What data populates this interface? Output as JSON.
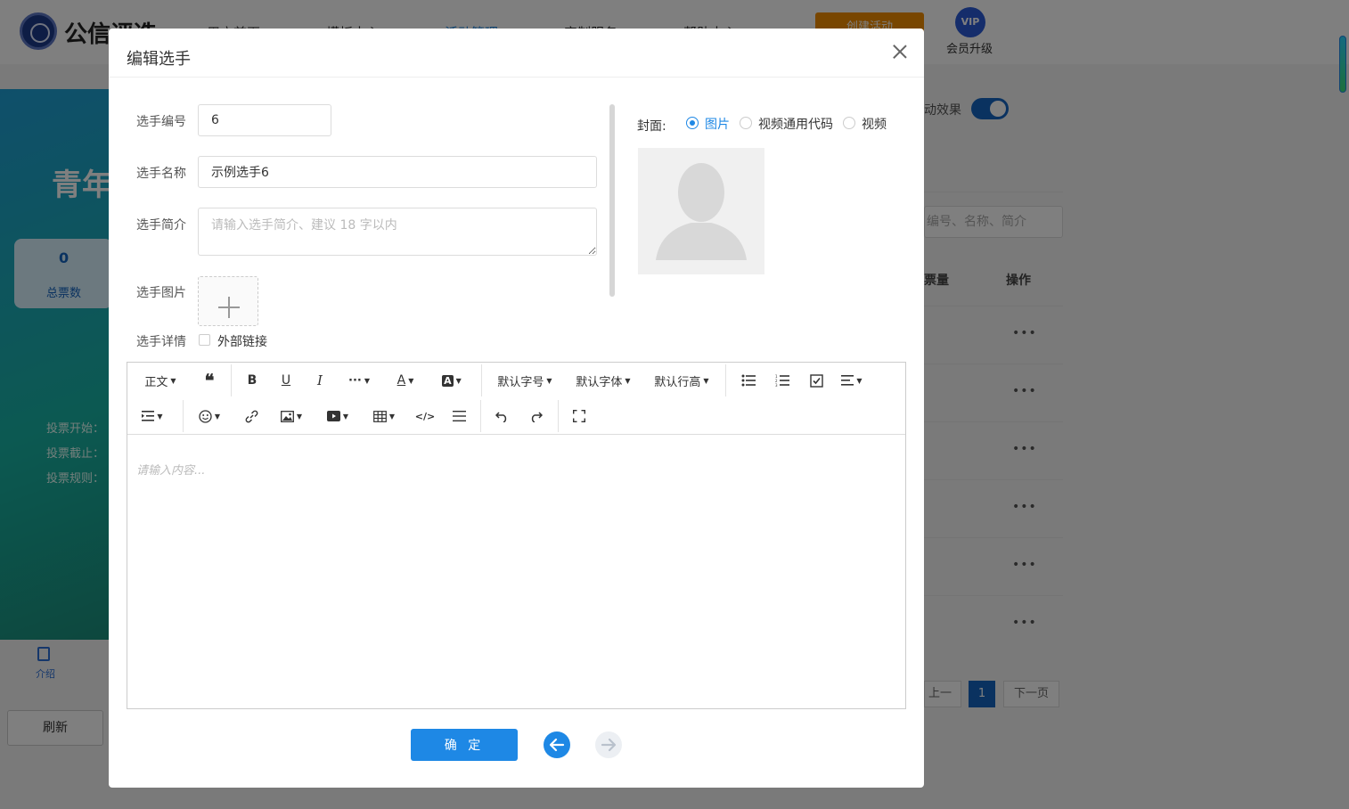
{
  "brand": {
    "name": "公信评选"
  },
  "nav": {
    "items": [
      "用户首页",
      "模板中心",
      "活动管理",
      "定制服务",
      "帮助中心"
    ],
    "active": "活动管理"
  },
  "header": {
    "create_button": "创建活动",
    "vip_badge": "VIP",
    "vip_label": "会员升级"
  },
  "background": {
    "banner_title": "青年",
    "stat_value": "0",
    "stat_label": "总票数",
    "vote_start": "投票开始：",
    "vote_end": "投票截止：",
    "vote_rule": "投票规则：",
    "intro_tab": "介绍",
    "refresh_button": "刷新",
    "effect_label": "动效果",
    "search_placeholder": "编号、名称、简介",
    "col_votes": "票量",
    "col_actions": "操作",
    "row_action": "•••",
    "pager_prev": "上一页",
    "pager_current": "1",
    "pager_next": "下一页"
  },
  "modal": {
    "title": "编辑选手",
    "fields": {
      "number_label": "选手编号",
      "number_value": "6",
      "name_label": "选手名称",
      "name_value": "示例选手6",
      "intro_label": "选手简介",
      "intro_placeholder": "请输入选手简介、建议 18 字以内",
      "image_label": "选手图片",
      "detail_label": "选手详情",
      "external_link_label": "外部链接"
    },
    "cover": {
      "label": "封面:",
      "options": [
        "图片",
        "视频通用代码",
        "视频"
      ],
      "selected": "图片"
    },
    "editor": {
      "toolbar": {
        "paragraph": "正文",
        "font_size": "默认字号",
        "font_family": "默认字体",
        "line_height": "默认行高"
      },
      "placeholder": "请输入内容..."
    },
    "confirm_button": "确 定"
  },
  "colors": {
    "primary": "#1e88e5",
    "accent_orange": "#f08c00"
  }
}
